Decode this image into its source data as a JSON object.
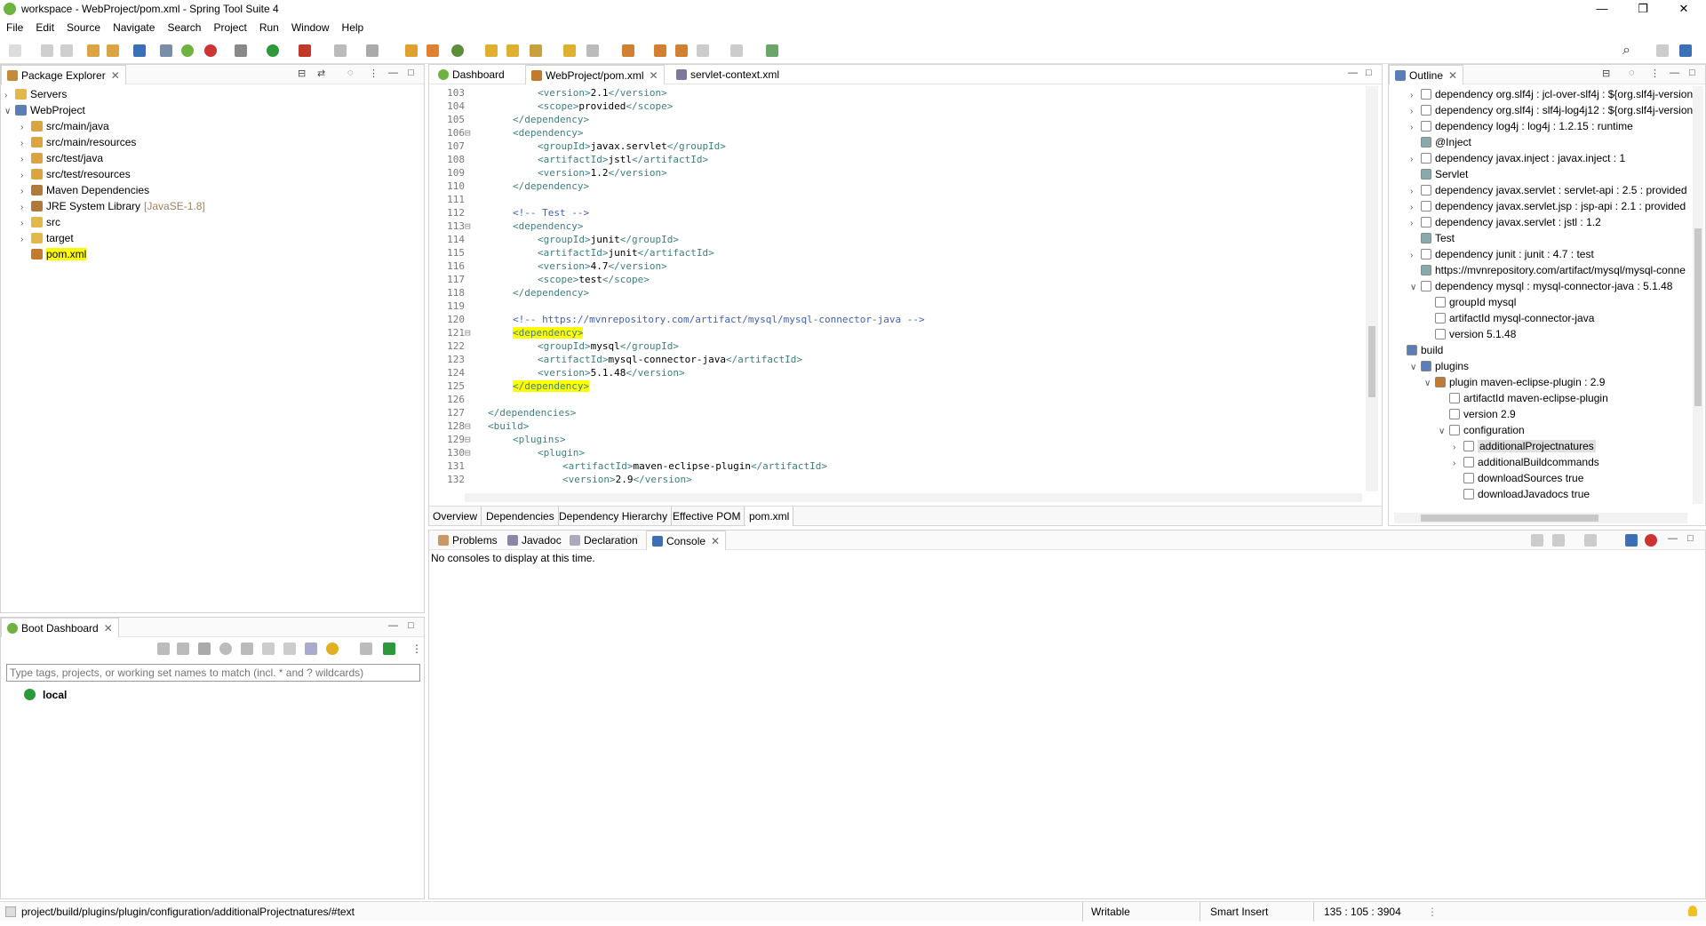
{
  "window": {
    "title": "workspace - WebProject/pom.xml - Spring Tool Suite 4",
    "minimize_glyph": "—",
    "restore_glyph": "❐",
    "close_glyph": "✕"
  },
  "menu": [
    "File",
    "Edit",
    "Source",
    "Navigate",
    "Search",
    "Project",
    "Run",
    "Window",
    "Help"
  ],
  "package_explorer": {
    "title": "Package Explorer",
    "items": [
      {
        "label": "Servers",
        "indent": 0,
        "arrow": "›",
        "icon": "folder-icon"
      },
      {
        "label": "WebProject",
        "indent": 0,
        "arrow": "∨",
        "icon": "project-icon"
      },
      {
        "label": "src/main/java",
        "indent": 1,
        "arrow": "›",
        "icon": "source-folder-icon"
      },
      {
        "label": "src/main/resources",
        "indent": 1,
        "arrow": "›",
        "icon": "source-folder-icon"
      },
      {
        "label": "src/test/java",
        "indent": 1,
        "arrow": "›",
        "icon": "source-folder-icon"
      },
      {
        "label": "src/test/resources",
        "indent": 1,
        "arrow": "›",
        "icon": "source-folder-icon"
      },
      {
        "label": "Maven Dependencies",
        "indent": 1,
        "arrow": "›",
        "icon": "library-icon"
      },
      {
        "label": "JRE System Library",
        "suffix": "[JavaSE-1.8]",
        "indent": 1,
        "arrow": "›",
        "icon": "library-icon"
      },
      {
        "label": "src",
        "indent": 1,
        "arrow": "›",
        "icon": "folder-icon"
      },
      {
        "label": "target",
        "indent": 1,
        "arrow": "›",
        "icon": "folder-icon"
      },
      {
        "label": "pom.xml",
        "indent": 1,
        "arrow": "",
        "icon": "maven-file-icon",
        "highlight": true
      }
    ]
  },
  "boot_dashboard": {
    "title": "Boot Dashboard",
    "filter_placeholder": "Type tags, projects, or working set names to match (incl. * and ? wildcards)",
    "items": [
      "local"
    ]
  },
  "editor": {
    "tabs": [
      "Dashboard",
      "WebProject/pom.xml",
      "servlet-context.xml"
    ],
    "active_tab": 1,
    "bottom_tabs": [
      "Overview",
      "Dependencies",
      "Dependency Hierarchy",
      "Effective POM",
      "pom.xml"
    ],
    "lines": [
      {
        "n": "103",
        "fold": "",
        "indent": 2,
        "parts": [
          [
            "tag",
            "<version>"
          ],
          [
            "txt",
            "2.1"
          ],
          [
            "tag",
            "</version>"
          ]
        ]
      },
      {
        "n": "104",
        "fold": "",
        "indent": 2,
        "parts": [
          [
            "tag",
            "<scope>"
          ],
          [
            "txt",
            "provided"
          ],
          [
            "tag",
            "</scope>"
          ]
        ]
      },
      {
        "n": "105",
        "fold": "",
        "indent": 1,
        "parts": [
          [
            "tag",
            "</dependency>"
          ]
        ]
      },
      {
        "n": "106",
        "fold": "⊟",
        "indent": 1,
        "parts": [
          [
            "tag",
            "<dependency>"
          ]
        ]
      },
      {
        "n": "107",
        "fold": "",
        "indent": 2,
        "parts": [
          [
            "tag",
            "<groupId>"
          ],
          [
            "txt",
            "javax.servlet"
          ],
          [
            "tag",
            "</groupId>"
          ]
        ]
      },
      {
        "n": "108",
        "fold": "",
        "indent": 2,
        "parts": [
          [
            "tag",
            "<artifactId>"
          ],
          [
            "txt",
            "jstl"
          ],
          [
            "tag",
            "</artifactId>"
          ]
        ]
      },
      {
        "n": "109",
        "fold": "",
        "indent": 2,
        "parts": [
          [
            "tag",
            "<version>"
          ],
          [
            "txt",
            "1.2"
          ],
          [
            "tag",
            "</version>"
          ]
        ]
      },
      {
        "n": "110",
        "fold": "",
        "indent": 1,
        "parts": [
          [
            "tag",
            "</dependency>"
          ]
        ]
      },
      {
        "n": "111",
        "fold": "",
        "indent": 0,
        "parts": []
      },
      {
        "n": "112",
        "fold": "",
        "indent": 1,
        "parts": [
          [
            "cmt",
            "<!-- Test -->"
          ]
        ]
      },
      {
        "n": "113",
        "fold": "⊟",
        "indent": 1,
        "parts": [
          [
            "tag",
            "<dependency>"
          ]
        ]
      },
      {
        "n": "114",
        "fold": "",
        "indent": 2,
        "parts": [
          [
            "tag",
            "<groupId>"
          ],
          [
            "txt",
            "junit"
          ],
          [
            "tag",
            "</groupId>"
          ]
        ]
      },
      {
        "n": "115",
        "fold": "",
        "indent": 2,
        "parts": [
          [
            "tag",
            "<artifactId>"
          ],
          [
            "txt",
            "junit"
          ],
          [
            "tag",
            "</artifactId>"
          ]
        ]
      },
      {
        "n": "116",
        "fold": "",
        "indent": 2,
        "parts": [
          [
            "tag",
            "<version>"
          ],
          [
            "txt",
            "4.7"
          ],
          [
            "tag",
            "</version>"
          ]
        ]
      },
      {
        "n": "117",
        "fold": "",
        "indent": 2,
        "parts": [
          [
            "tag",
            "<scope>"
          ],
          [
            "txt",
            "test"
          ],
          [
            "tag",
            "</scope>"
          ]
        ]
      },
      {
        "n": "118",
        "fold": "",
        "indent": 1,
        "parts": [
          [
            "tag",
            "</dependency>"
          ]
        ]
      },
      {
        "n": "119",
        "fold": "",
        "indent": 0,
        "parts": []
      },
      {
        "n": "120",
        "fold": "",
        "indent": 1,
        "parts": [
          [
            "cmt",
            "<!-- https://mvnrepository.com/artifact/mysql/mysql-connector-java -->"
          ]
        ]
      },
      {
        "n": "121",
        "fold": "⊟",
        "indent": 1,
        "parts": [
          [
            "hltag",
            "<dependency>"
          ]
        ]
      },
      {
        "n": "122",
        "fold": "",
        "indent": 2,
        "parts": [
          [
            "tag",
            "<groupId>"
          ],
          [
            "txt",
            "mysql"
          ],
          [
            "tag",
            "</groupId>"
          ]
        ]
      },
      {
        "n": "123",
        "fold": "",
        "indent": 2,
        "parts": [
          [
            "tag",
            "<artifactId>"
          ],
          [
            "txt",
            "mysql-connector-java"
          ],
          [
            "tag",
            "</artifactId>"
          ]
        ]
      },
      {
        "n": "124",
        "fold": "",
        "indent": 2,
        "parts": [
          [
            "tag",
            "<version>"
          ],
          [
            "txt",
            "5.1.48"
          ],
          [
            "tag",
            "</version>"
          ]
        ]
      },
      {
        "n": "125",
        "fold": "",
        "indent": 1,
        "parts": [
          [
            "hltag",
            "</dependency>"
          ]
        ]
      },
      {
        "n": "126",
        "fold": "",
        "indent": 0,
        "parts": []
      },
      {
        "n": "127",
        "fold": "",
        "indent": 0,
        "parts": [
          [
            "tag",
            "</dependencies>"
          ]
        ]
      },
      {
        "n": "128",
        "fold": "⊟",
        "indent": 0,
        "parts": [
          [
            "tag",
            "<build>"
          ]
        ]
      },
      {
        "n": "129",
        "fold": "⊟",
        "indent": 1,
        "parts": [
          [
            "tag",
            "<plugins>"
          ]
        ]
      },
      {
        "n": "130",
        "fold": "⊟",
        "indent": 2,
        "parts": [
          [
            "tag",
            "<plugin>"
          ]
        ]
      },
      {
        "n": "131",
        "fold": "",
        "indent": 3,
        "parts": [
          [
            "tag",
            "<artifactId>"
          ],
          [
            "txt",
            "maven-eclipse-plugin"
          ],
          [
            "tag",
            "</artifactId>"
          ]
        ]
      },
      {
        "n": "132",
        "fold": "",
        "indent": 3,
        "parts": [
          [
            "tag",
            "<version>"
          ],
          [
            "txt",
            "2.9"
          ],
          [
            "tag",
            "</version>"
          ]
        ]
      }
    ]
  },
  "outline": {
    "title": "Outline",
    "rows": [
      {
        "indent": 0,
        "arrow": "›",
        "icon": "file-icon",
        "text": "dependency  org.slf4j : jcl-over-slf4j : ${org.slf4j-version"
      },
      {
        "indent": 0,
        "arrow": "›",
        "icon": "file-icon",
        "text": "dependency  org.slf4j : slf4j-log4j12 : ${org.slf4j-version"
      },
      {
        "indent": 0,
        "arrow": "›",
        "icon": "file-icon",
        "text": "dependency  log4j : log4j : 1.2.15 : runtime"
      },
      {
        "indent": 0,
        "arrow": "",
        "icon": "comment-icon",
        "text": "@Inject"
      },
      {
        "indent": 0,
        "arrow": "›",
        "icon": "file-icon",
        "text": "dependency  javax.inject : javax.inject : 1"
      },
      {
        "indent": 0,
        "arrow": "",
        "icon": "comment-icon",
        "text": "Servlet"
      },
      {
        "indent": 0,
        "arrow": "›",
        "icon": "file-icon",
        "text": "dependency  javax.servlet : servlet-api : 2.5 : provided"
      },
      {
        "indent": 0,
        "arrow": "›",
        "icon": "file-icon",
        "text": "dependency  javax.servlet.jsp : jsp-api : 2.1 : provided"
      },
      {
        "indent": 0,
        "arrow": "›",
        "icon": "file-icon",
        "text": "dependency  javax.servlet : jstl : 1.2"
      },
      {
        "indent": 0,
        "arrow": "",
        "icon": "comment-icon",
        "text": "Test"
      },
      {
        "indent": 0,
        "arrow": "›",
        "icon": "file-icon",
        "text": "dependency  junit : junit : 4.7 : test"
      },
      {
        "indent": 0,
        "arrow": "",
        "icon": "comment-icon",
        "text": "https://mvnrepository.com/artifact/mysql/mysql-conne"
      },
      {
        "indent": 0,
        "arrow": "∨",
        "icon": "file-icon",
        "text": "dependency  mysql : mysql-connector-java : 5.1.48"
      },
      {
        "indent": 1,
        "arrow": "",
        "icon": "element-icon",
        "text": "groupId  mysql"
      },
      {
        "indent": 1,
        "arrow": "",
        "icon": "element-icon",
        "text": "artifactId  mysql-connector-java"
      },
      {
        "indent": 1,
        "arrow": "",
        "icon": "element-icon",
        "text": "version  5.1.48"
      },
      {
        "indent": -1,
        "arrow": "",
        "icon": "build-icon",
        "text": "build"
      },
      {
        "indent": 0,
        "arrow": "∨",
        "icon": "plugins-icon",
        "text": "plugins"
      },
      {
        "indent": 1,
        "arrow": "∨",
        "icon": "plugin-icon",
        "text": "plugin  maven-eclipse-plugin : 2.9"
      },
      {
        "indent": 2,
        "arrow": "",
        "icon": "element-icon",
        "text": "artifactId  maven-eclipse-plugin"
      },
      {
        "indent": 2,
        "arrow": "",
        "icon": "element-icon",
        "text": "version  2.9"
      },
      {
        "indent": 2,
        "arrow": "∨",
        "icon": "element-icon",
        "text": "configuration"
      },
      {
        "indent": 3,
        "arrow": "›",
        "icon": "element-icon",
        "text": "additionalProjectnatures",
        "selected": true
      },
      {
        "indent": 3,
        "arrow": "›",
        "icon": "element-icon",
        "text": "additionalBuildcommands"
      },
      {
        "indent": 3,
        "arrow": "",
        "icon": "element-icon",
        "text": "downloadSources  true"
      },
      {
        "indent": 3,
        "arrow": "",
        "icon": "element-icon",
        "text": "downloadJavadocs  true"
      }
    ]
  },
  "console": {
    "tabs": [
      "Problems",
      "Javadoc",
      "Declaration",
      "Console"
    ],
    "active_tab": 3,
    "message": "No consoles to display at this time."
  },
  "status": {
    "path": "project/build/plugins/plugin/configuration/additionalProjectnatures/#text",
    "writable": "Writable",
    "insert_mode": "Smart Insert",
    "position": "135 : 105 : 3904"
  },
  "colors": {
    "accent": "#3b6fb6",
    "highlight": "#ffff00",
    "spring_green": "#6db33f",
    "xml_tag": "#3f7f7f",
    "xml_comment": "#3f5fbf"
  }
}
